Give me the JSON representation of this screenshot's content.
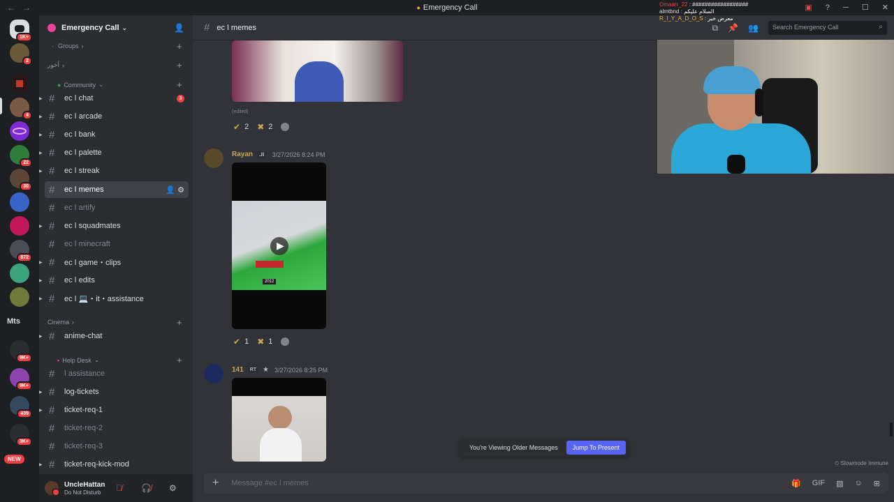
{
  "window": {
    "title": "Emergency Call"
  },
  "server": {
    "name": "Emergency Call",
    "channel": "ec ǀ memes"
  },
  "server_badges": [
    "1K+",
    "2",
    "4",
    "22",
    "30",
    "872",
    "9K+",
    "9K+",
    "439",
    "3K+",
    "1K+"
  ],
  "server_text": "Mts",
  "new_label": "NEW",
  "categories": {
    "groups": "Groups",
    "akhor": "أخور",
    "community": "Community",
    "cinema": "Cinema",
    "helpdesk": "Help Desk"
  },
  "channels": [
    {
      "label": "ec ǀ chat",
      "badge": "3"
    },
    {
      "label": "ec ǀ arcade"
    },
    {
      "label": "ec ǀ bank"
    },
    {
      "label": "ec ǀ palette"
    },
    {
      "label": "ec ǀ streak"
    },
    {
      "label": "ec ǀ memes"
    },
    {
      "label": "ec ǀ artify"
    },
    {
      "label": "ec ǀ squadmates"
    },
    {
      "label": "ec ǀ minecraft"
    },
    {
      "label": "ec ǀ game・clips"
    },
    {
      "label": "ec ǀ edits"
    },
    {
      "label": "ec ǀ 💻・it・assistance"
    },
    {
      "label": "anime-chat"
    },
    {
      "label": "ǀ assistance"
    },
    {
      "label": "log-tickets"
    },
    {
      "label": "ticket-req-1"
    },
    {
      "label": "ticket-req-2"
    },
    {
      "label": "ticket-req-3"
    },
    {
      "label": "ticket-req-kick-mod"
    }
  ],
  "user": {
    "name": "UncleHattan",
    "status": "Do Not Disturb"
  },
  "search": {
    "placeholder": "Search Emergency Call"
  },
  "messages": [
    {
      "edited": "(edited)",
      "reactions": [
        {
          "emoji": "check",
          "count": "2"
        },
        {
          "emoji": "x",
          "count": "2"
        }
      ]
    },
    {
      "author": "Rayan",
      "author_color": "#c9a954",
      "tag": "الـ",
      "time": "3/27/2026 8:24 PM",
      "video_caption": "2012",
      "reactions": [
        {
          "emoji": "check",
          "count": "1"
        },
        {
          "emoji": "x",
          "count": "1"
        }
      ]
    },
    {
      "author": "141",
      "author_color": "#c9a954",
      "tag": "RT",
      "time": "3/27/2026 8:25 PM"
    }
  ],
  "older_bar": {
    "text": "You're Viewing Older Messages",
    "button": "Jump To Present"
  },
  "slowmode": "Slowmode Immune",
  "composer": {
    "placeholder": "Message #ec ǀ memes"
  },
  "overlay_chat": [
    {
      "name": "Omaarr_22",
      "text": "##################",
      "color": "#f23f43"
    },
    {
      "name": "almtbnd",
      "text": "السلام عليكم",
      "color": "#dbdee1"
    },
    {
      "name": "R_I_Y_A_D_O_S",
      "text": "معرض خير",
      "color": "#f0b232"
    }
  ],
  "colors": {
    "accent": "#5865f2",
    "danger": "#f23f43",
    "bg": "#313338"
  }
}
